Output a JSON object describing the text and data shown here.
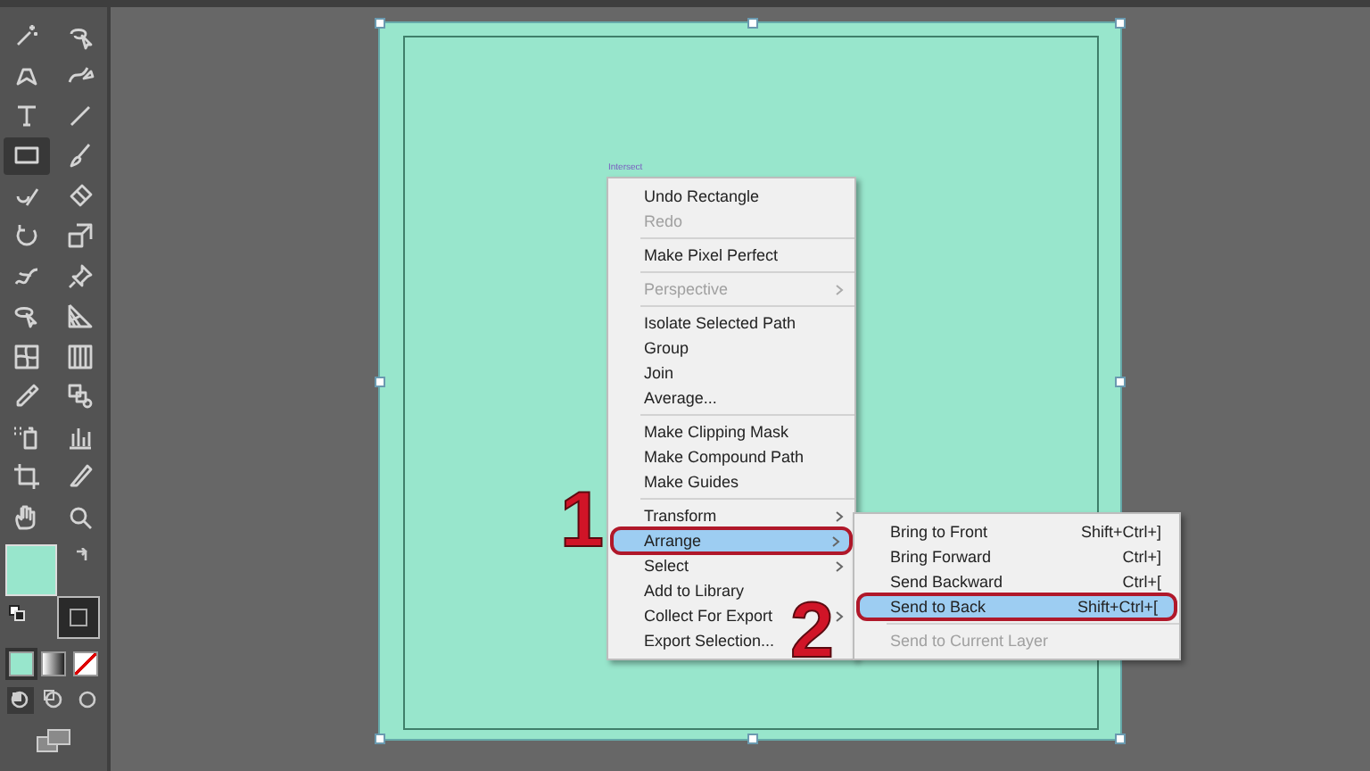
{
  "tools": [
    {
      "kind": "wand",
      "selected": false
    },
    {
      "kind": "lasso",
      "selected": false
    },
    {
      "kind": "pen",
      "selected": false
    },
    {
      "kind": "curvature",
      "selected": false
    },
    {
      "kind": "type",
      "selected": false
    },
    {
      "kind": "line",
      "selected": false
    },
    {
      "kind": "rectangle",
      "selected": true
    },
    {
      "kind": "brush",
      "selected": false
    },
    {
      "kind": "shaper",
      "selected": false
    },
    {
      "kind": "eraser",
      "selected": false
    },
    {
      "kind": "rotate",
      "selected": false
    },
    {
      "kind": "scale",
      "selected": false
    },
    {
      "kind": "warp",
      "selected": false
    },
    {
      "kind": "pin",
      "selected": false
    },
    {
      "kind": "transform",
      "selected": false
    },
    {
      "kind": "perspective",
      "selected": false
    },
    {
      "kind": "mesh",
      "selected": false
    },
    {
      "kind": "gradient",
      "selected": false
    },
    {
      "kind": "eyedropper",
      "selected": false
    },
    {
      "kind": "blend",
      "selected": false
    },
    {
      "kind": "sprayer",
      "selected": false
    },
    {
      "kind": "graph",
      "selected": false
    },
    {
      "kind": "artboard",
      "selected": false
    },
    {
      "kind": "knife",
      "selected": false
    },
    {
      "kind": "hand",
      "selected": false
    },
    {
      "kind": "zoom",
      "selected": false
    }
  ],
  "color_modes": [
    {
      "kind": "color",
      "selected": true
    },
    {
      "kind": "gradient",
      "selected": false
    },
    {
      "kind": "none",
      "selected": false
    }
  ],
  "draw_modes": [
    {
      "kind": "normal",
      "selected": true
    },
    {
      "kind": "behind",
      "selected": false
    },
    {
      "kind": "inside",
      "selected": false
    }
  ],
  "hover_label": "Intersect",
  "context_menu": {
    "groups": [
      [
        {
          "label": "Undo Rectangle",
          "disabled": false,
          "submenu": false,
          "selected": false
        },
        {
          "label": "Redo",
          "disabled": true,
          "submenu": false,
          "selected": false
        }
      ],
      [
        {
          "label": "Make Pixel Perfect",
          "disabled": false,
          "submenu": false,
          "selected": false
        }
      ],
      [
        {
          "label": "Perspective",
          "disabled": true,
          "submenu": true,
          "selected": false
        }
      ],
      [
        {
          "label": "Isolate Selected Path",
          "disabled": false,
          "submenu": false,
          "selected": false
        },
        {
          "label": "Group",
          "disabled": false,
          "submenu": false,
          "selected": false
        },
        {
          "label": "Join",
          "disabled": false,
          "submenu": false,
          "selected": false
        },
        {
          "label": "Average...",
          "disabled": false,
          "submenu": false,
          "selected": false
        }
      ],
      [
        {
          "label": "Make Clipping Mask",
          "disabled": false,
          "submenu": false,
          "selected": false
        },
        {
          "label": "Make Compound Path",
          "disabled": false,
          "submenu": false,
          "selected": false
        },
        {
          "label": "Make Guides",
          "disabled": false,
          "submenu": false,
          "selected": false
        }
      ],
      [
        {
          "label": "Transform",
          "disabled": false,
          "submenu": true,
          "selected": false
        },
        {
          "label": "Arrange",
          "disabled": false,
          "submenu": true,
          "selected": true
        },
        {
          "label": "Select",
          "disabled": false,
          "submenu": true,
          "selected": false
        },
        {
          "label": "Add to Library",
          "disabled": false,
          "submenu": false,
          "selected": false
        },
        {
          "label": "Collect For Export",
          "disabled": false,
          "submenu": true,
          "selected": false
        },
        {
          "label": "Export Selection...",
          "disabled": false,
          "submenu": false,
          "selected": false
        }
      ]
    ]
  },
  "submenu": {
    "groups": [
      [
        {
          "label": "Bring to Front",
          "shortcut": "Shift+Ctrl+]",
          "disabled": false,
          "selected": false
        },
        {
          "label": "Bring Forward",
          "shortcut": "Ctrl+]",
          "disabled": false,
          "selected": false
        },
        {
          "label": "Send Backward",
          "shortcut": "Ctrl+[",
          "disabled": false,
          "selected": false
        },
        {
          "label": "Send to Back",
          "shortcut": "Shift+Ctrl+[",
          "disabled": false,
          "selected": true
        }
      ],
      [
        {
          "label": "Send to Current Layer",
          "disabled": true,
          "selected": false
        }
      ]
    ]
  },
  "callouts": [
    {
      "label": "1"
    },
    {
      "label": "2"
    }
  ]
}
